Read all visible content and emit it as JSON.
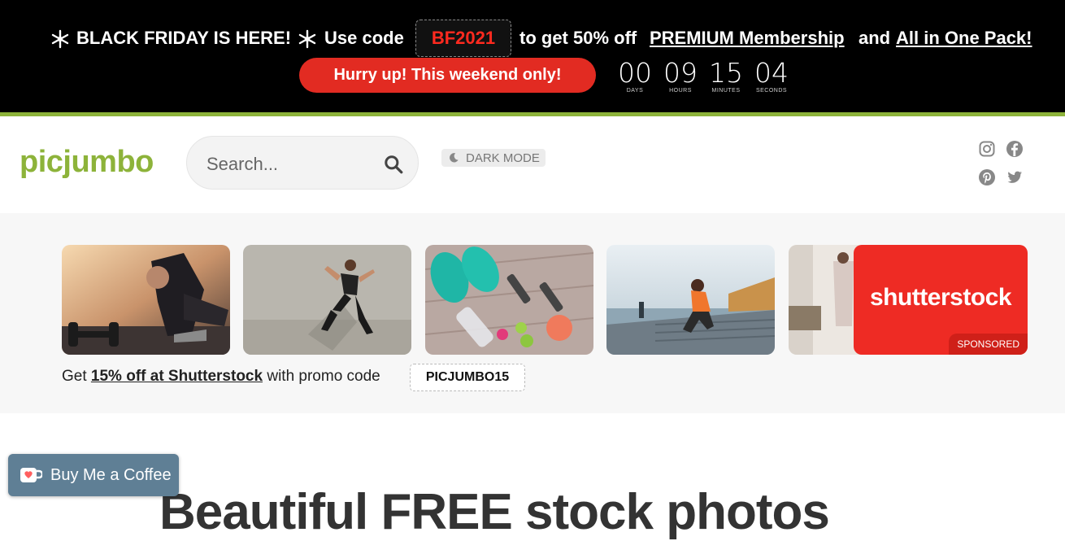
{
  "promo": {
    "headline": "BLACK FRIDAY IS HERE!",
    "use_code": "Use code",
    "code": "BF2021",
    "to_get": "to get 50% off",
    "premium_link": "PREMIUM Membership",
    "and": "and",
    "pack_link": "All in One Pack!",
    "hurry": "Hurry up! This weekend only!",
    "countdown": [
      {
        "value": "00",
        "label": "DAYS"
      },
      {
        "value": "09",
        "label": "HOURS"
      },
      {
        "value": "15",
        "label": "MINUTES"
      },
      {
        "value": "04",
        "label": "SECONDS"
      }
    ]
  },
  "header": {
    "logo": "picjumbo",
    "search_placeholder": "Search...",
    "dark_mode": "DARK MODE"
  },
  "sponsored": {
    "shutterstock_logo": "shutterstock",
    "sponsored_label": "SPONSORED",
    "promo_prefix": "Get",
    "promo_link": "15% off at Shutterstock",
    "promo_suffix": "with promo code",
    "promo_code": "PICJUMBO15"
  },
  "main": {
    "headline": "Beautiful FREE stock photos"
  },
  "bmc": {
    "label": "Buy Me a Coffee"
  },
  "colors": {
    "brand_green": "#8db33a",
    "promo_red": "#e22b22",
    "shutterstock_red": "#ee2b24"
  }
}
